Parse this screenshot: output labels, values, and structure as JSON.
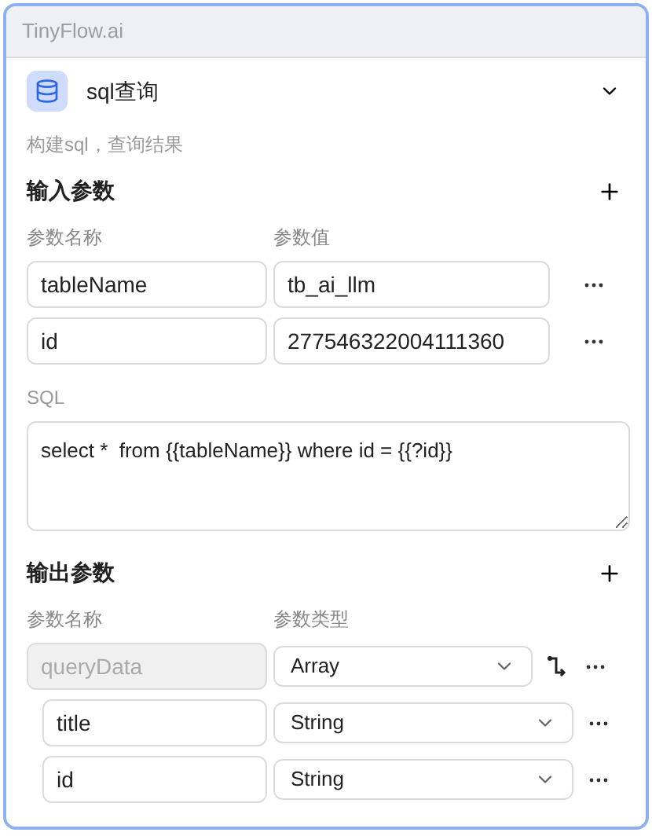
{
  "window": {
    "title": "TinyFlow.ai"
  },
  "node": {
    "title": "sql查询",
    "expanded": true,
    "description": "构建sql，查询结果"
  },
  "inputs": {
    "title": "输入参数",
    "columns": [
      "参数名称",
      "参数值"
    ],
    "rows": [
      {
        "name": "tableName",
        "value": "tb_ai_llm"
      },
      {
        "name": "id",
        "value": "277546322004111360"
      }
    ]
  },
  "sql": {
    "label": "SQL",
    "value": "select *  from {{tableName}} where id = {{?id}}"
  },
  "outputs": {
    "title": "输出参数",
    "columns": [
      "参数名称",
      "参数类型"
    ],
    "rows": [
      {
        "name": "queryData",
        "type": "Array",
        "disabled": true,
        "children": [
          {
            "name": "title",
            "type": "String",
            "disabled": false
          },
          {
            "name": "id",
            "type": "String",
            "disabled": false
          }
        ]
      }
    ]
  }
}
